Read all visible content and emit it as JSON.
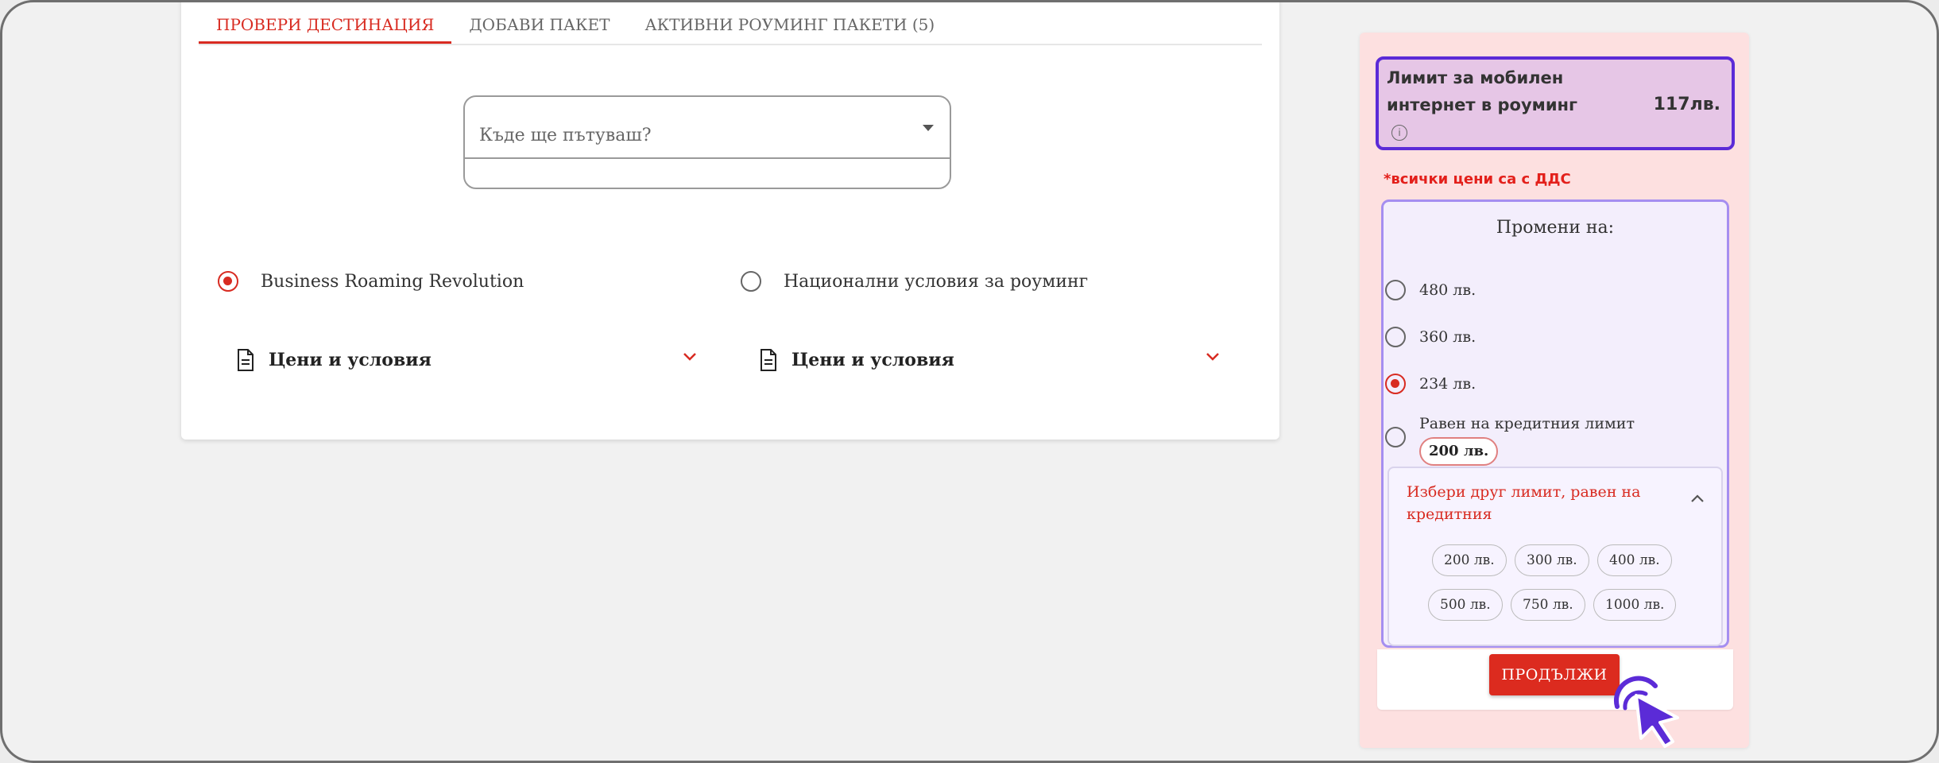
{
  "tabs": [
    {
      "label": "ПРОВЕРИ ДЕСТИНАЦИЯ",
      "active": true
    },
    {
      "label": "ДОБАВИ ПАКЕТ",
      "active": false
    },
    {
      "label": "АКТИВНИ РОУМИНГ ПАКЕТИ (5)",
      "active": false
    }
  ],
  "destination": {
    "placeholder": "Къде ще пътуваш?"
  },
  "plans": [
    {
      "label": "Business Roaming Revolution",
      "selected": true,
      "terms_label": "Цени и условия"
    },
    {
      "label": "Национални условия за роуминг",
      "selected": false,
      "terms_label": "Цени и условия"
    }
  ],
  "limit_panel": {
    "title": "Лимит за мобилен интернет в роуминг",
    "value": "117лв.",
    "info_icon": "i",
    "vat_note": "*всички цени са с ДДС",
    "change_title": "Промени на:",
    "options": [
      {
        "label": "480 лв.",
        "selected": false
      },
      {
        "label": "360 лв.",
        "selected": false
      },
      {
        "label": "234 лв.",
        "selected": true
      },
      {
        "label": "Равен на кредитния лимит",
        "chip": "200 лв.",
        "selected": false
      }
    ],
    "other_limit_title": "Избери друг лимит, равен на кредитния",
    "other_limit_chips": [
      "200 лв.",
      "300 лв.",
      "400 лв.",
      "500 лв.",
      "750 лв.",
      "1000 лв."
    ],
    "continue_label": "ПРОДЪЛЖИ"
  },
  "colors": {
    "accent_red": "#d82b21",
    "limit_border": "#5b2bd7",
    "limit_bg": "#e6c6e6",
    "panel_bg": "#fde0e0",
    "cursor": "#5b2bd7"
  }
}
